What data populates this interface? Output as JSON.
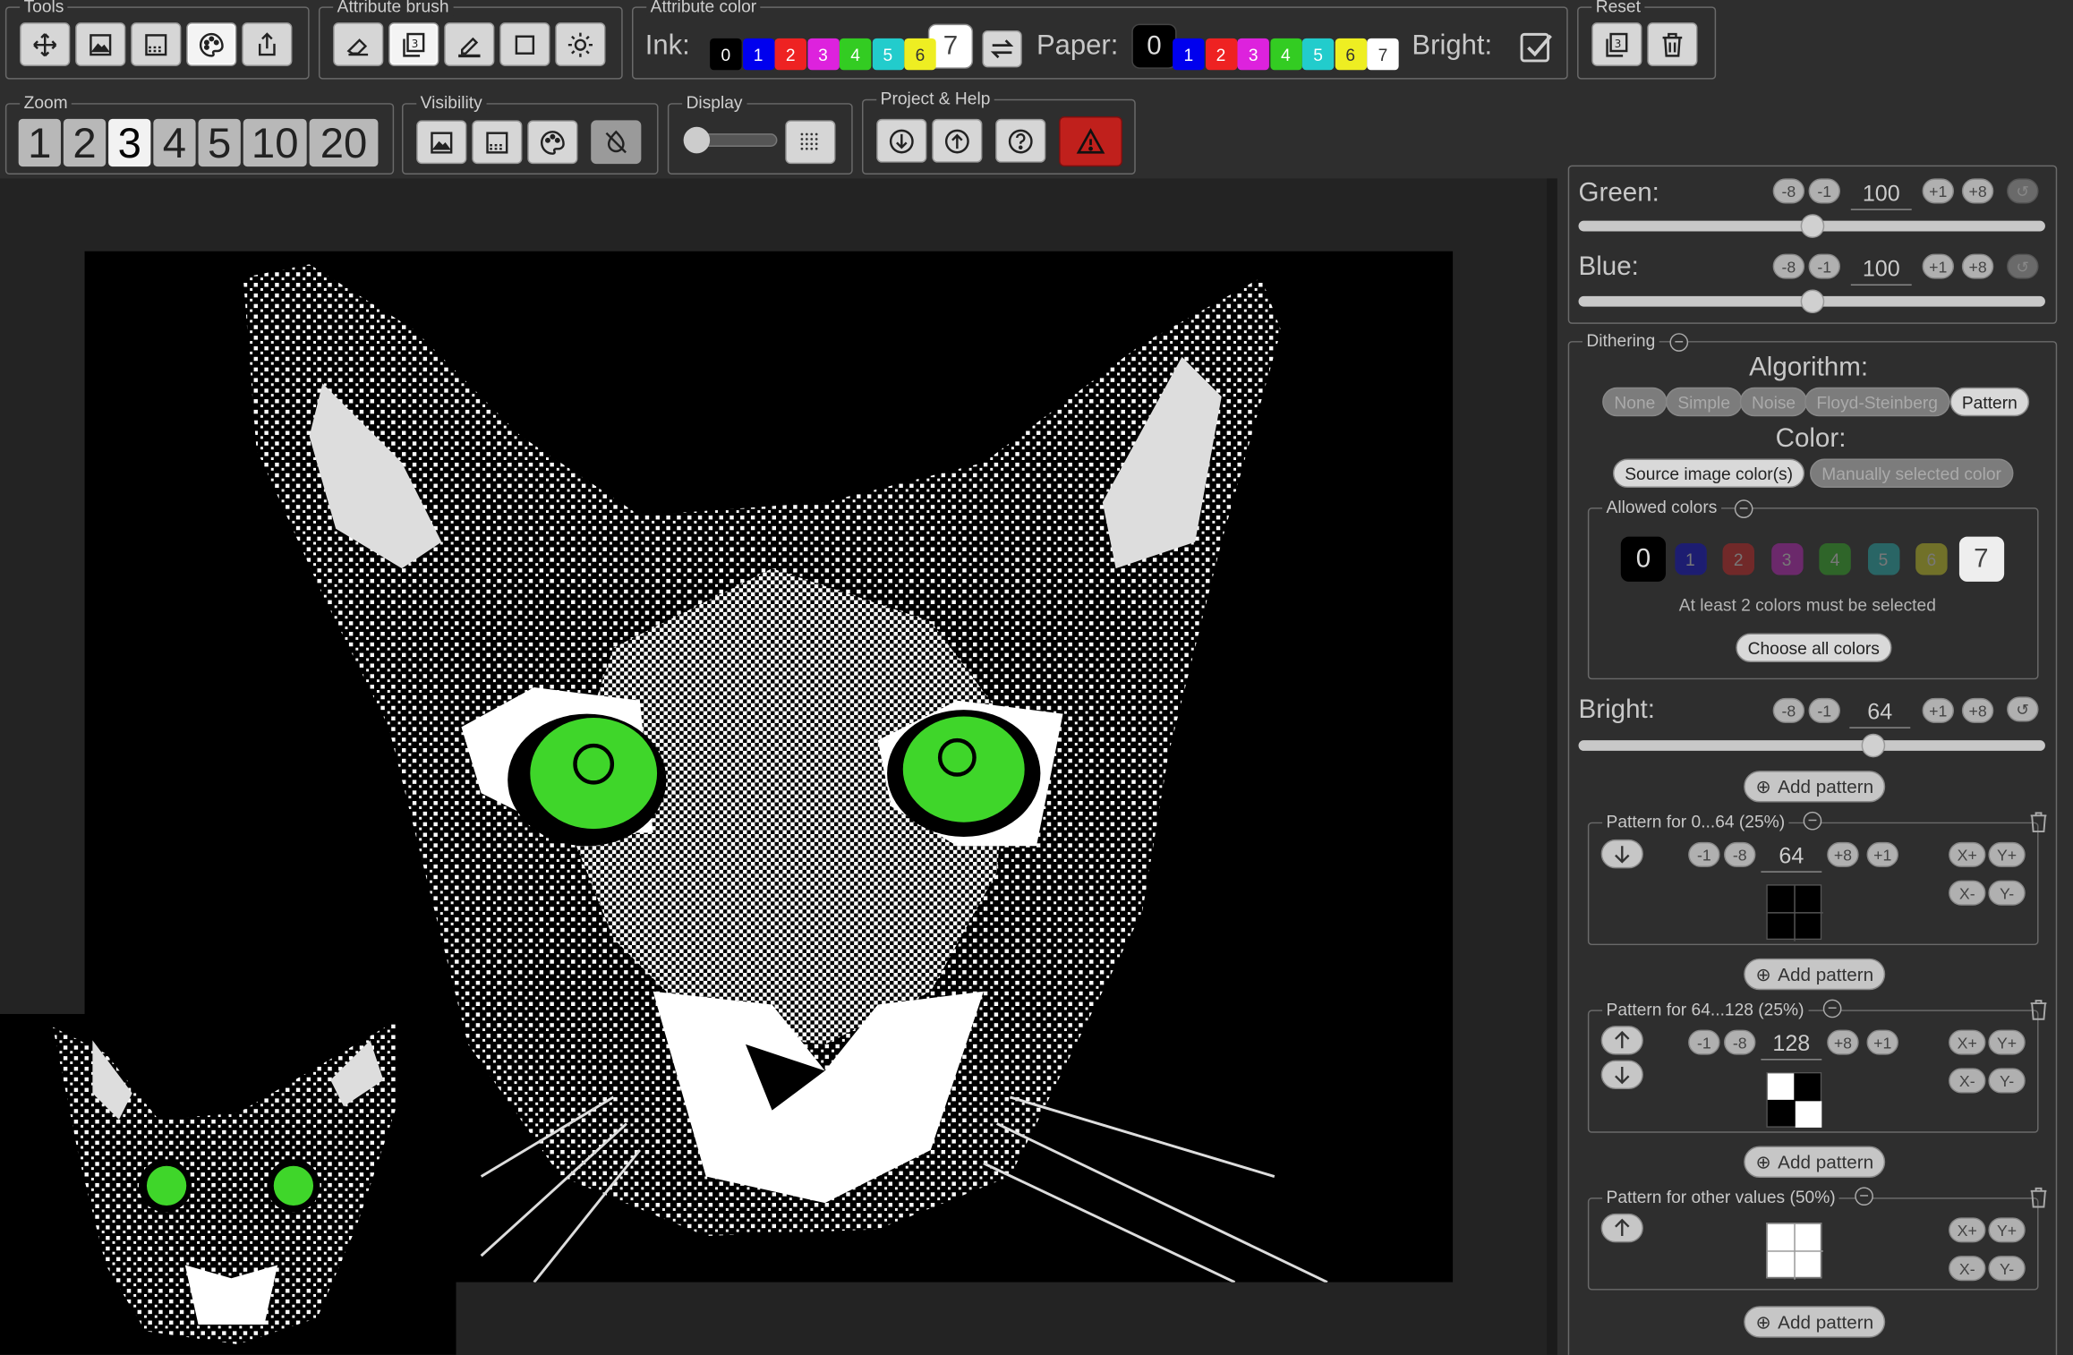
{
  "toolbar": {
    "tools_legend": "Tools",
    "brush_legend": "Attribute brush",
    "color_legend": "Attribute color",
    "reset_legend": "Reset",
    "ink_label": "Ink:",
    "paper_label": "Paper:",
    "bright_label": "Bright:",
    "ink_colors": [
      "0",
      "1",
      "2",
      "3",
      "4",
      "5",
      "6"
    ],
    "ink_selected": "7",
    "paper_selected": "0",
    "paper_colors": [
      "1",
      "2",
      "3",
      "4",
      "5",
      "6",
      "7"
    ],
    "palette": [
      "#000000",
      "#0000ee",
      "#ee2222",
      "#dd22dd",
      "#33cc22",
      "#22cccc",
      "#eeee22",
      "#ffffff"
    ]
  },
  "row2": {
    "zoom_legend": "Zoom",
    "zoom_levels": [
      "1",
      "2",
      "3",
      "4",
      "5",
      "10",
      "20"
    ],
    "zoom_active": "3",
    "visibility_legend": "Visibility",
    "display_legend": "Display",
    "project_legend": "Project & Help"
  },
  "panel": {
    "green_label": "Green:",
    "green_value": "100",
    "blue_label": "Blue:",
    "blue_value": "100",
    "step_minus8": "-8",
    "step_minus1": "-1",
    "step_plus1": "+1",
    "step_plus8": "+8",
    "dithering_legend": "Dithering",
    "algorithm_title": "Algorithm:",
    "algorithms": [
      "None",
      "Simple",
      "Noise",
      "Floyd-Steinberg",
      "Pattern"
    ],
    "algorithm_active": "Pattern",
    "color_title": "Color:",
    "color_opts": [
      "Source image color(s)",
      "Manually selected color"
    ],
    "allowed_legend": "Allowed colors",
    "allowed_colors": [
      "0",
      "1",
      "2",
      "3",
      "4",
      "5",
      "6",
      "7"
    ],
    "allowed_note": "At least 2 colors must be selected",
    "choose_all": "Choose all colors",
    "bright_label": "Bright:",
    "bright_value": "64",
    "add_pattern": "Add pattern",
    "pattern1_legend": "Pattern for 0...64 (25%)",
    "pattern1_value": "64",
    "pattern2_legend": "Pattern for 64...128 (25%)",
    "pattern2_value": "128",
    "pattern3_legend": "Pattern for other values (50%)",
    "xplus": "X+",
    "yplus": "Y+",
    "xminus": "X-",
    "yminus": "Y-"
  }
}
